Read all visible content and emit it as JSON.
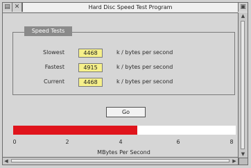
{
  "window": {
    "title": "Hard Disc Speed Test Program"
  },
  "speed_tests": {
    "tab_label": "Speed Tests",
    "rows": [
      {
        "label": "Slowest",
        "value": "4468",
        "unit": "k / bytes per second"
      },
      {
        "label": "Fastest",
        "value": "4915",
        "unit": "k / bytes per second"
      },
      {
        "label": "Current",
        "value": "4468",
        "unit": "k / bytes per second"
      }
    ]
  },
  "go_button": {
    "label": "Go"
  },
  "speed_bar": {
    "value_mbytes": 4.45,
    "max_mbytes": 8,
    "fill_color": "#e0141c",
    "ticks": [
      "0",
      "2",
      "4",
      "6",
      "8"
    ],
    "axis_label": "MBytes Per Second"
  },
  "icons": {
    "close": "close-icon",
    "back": "back-icon",
    "toggle_size": "toggle-size-icon"
  }
}
